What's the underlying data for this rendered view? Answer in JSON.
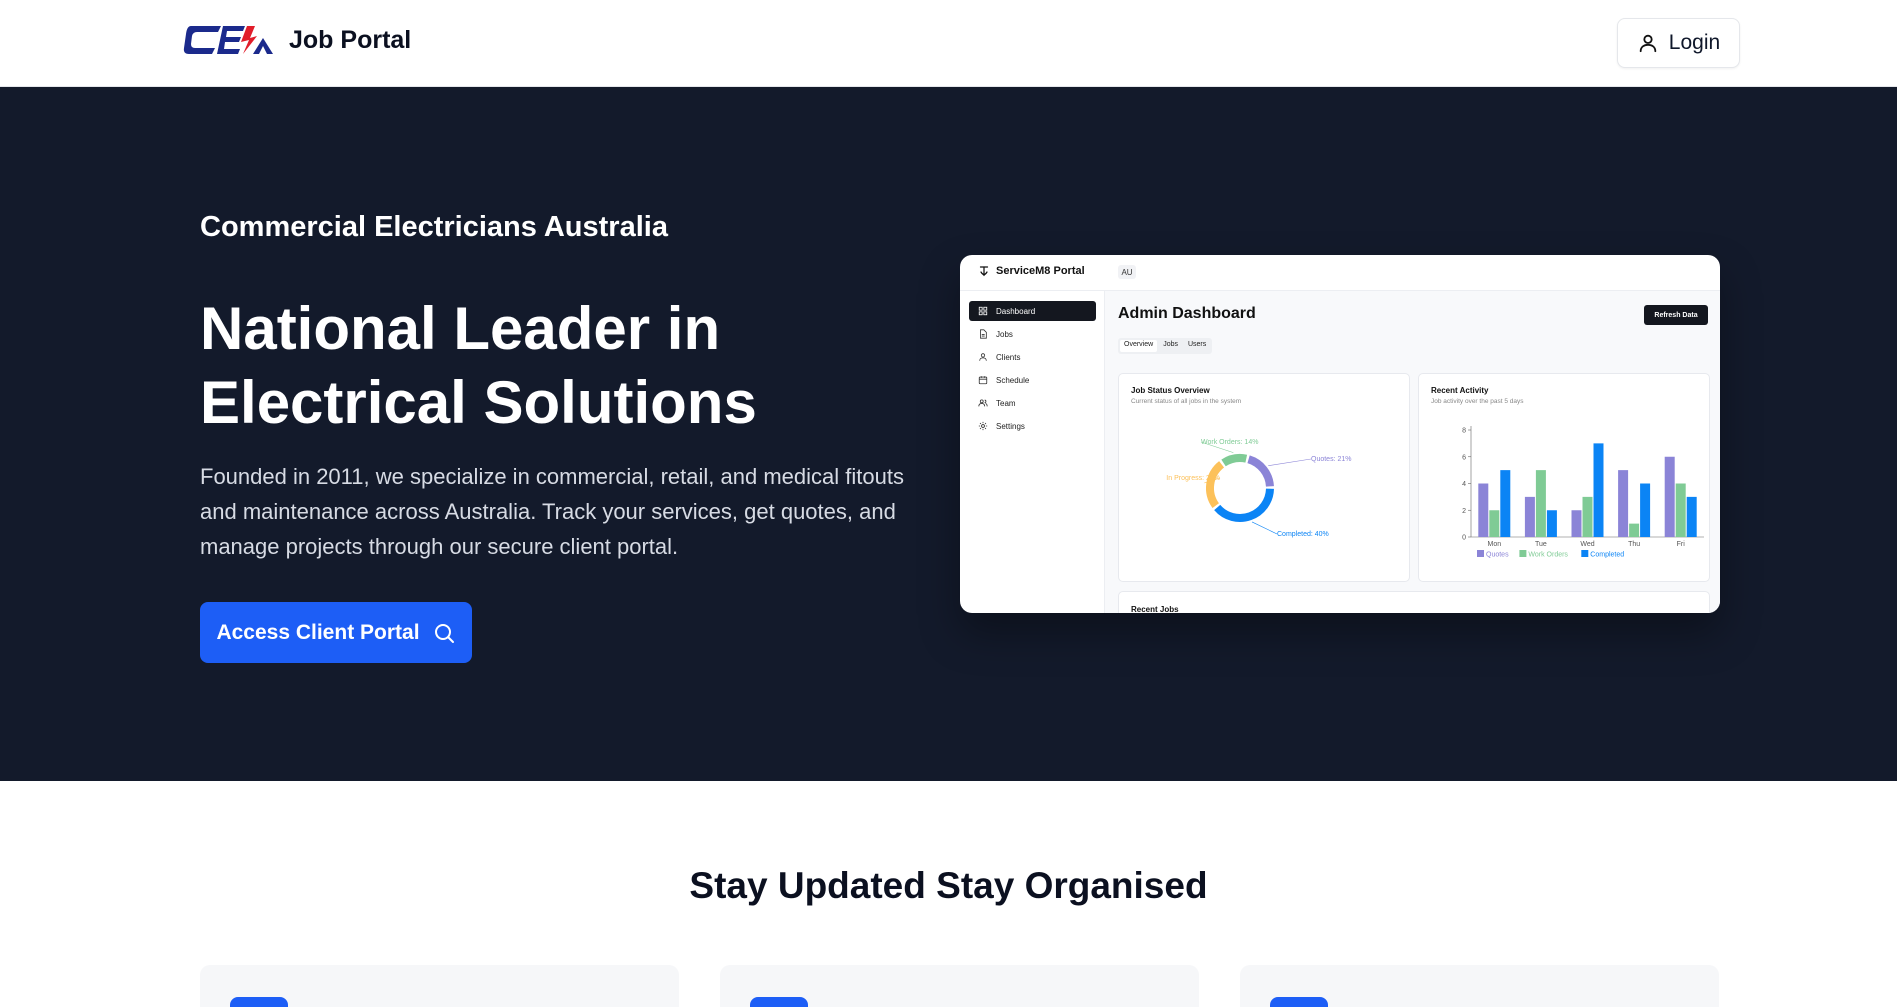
{
  "header": {
    "brand_title": "Job Portal",
    "logo_text": "CEA",
    "login_label": "Login",
    "colors": {
      "logo_blue": "#1b2a8c",
      "logo_red": "#e11d2a"
    }
  },
  "hero": {
    "eyebrow": "Commercial Electricians Australia",
    "title_line1": "National Leader in",
    "title_line2": "Electrical Solutions",
    "description": "Founded in 2011, we specialize in commercial, retail, and medical fitouts and maintenance across Australia. Track your services, get quotes, and manage projects through our secure client portal.",
    "cta_label": "Access Client Portal",
    "cta_icon": "search-icon",
    "colors": {
      "background": "#131a2b",
      "accent": "#1d5ef6"
    }
  },
  "dashboard_preview": {
    "app_name": "ServiceM8 Portal",
    "locale_badge": "AU",
    "sidebar": [
      {
        "label": "Dashboard",
        "icon": "grid-icon",
        "active": true
      },
      {
        "label": "Jobs",
        "icon": "file-icon",
        "active": false
      },
      {
        "label": "Clients",
        "icon": "user-icon",
        "active": false
      },
      {
        "label": "Schedule",
        "icon": "calendar-icon",
        "active": false
      },
      {
        "label": "Team",
        "icon": "users-icon",
        "active": false
      },
      {
        "label": "Settings",
        "icon": "gear-icon",
        "active": false
      }
    ],
    "page_title": "Admin Dashboard",
    "refresh_label": "Refresh Data",
    "tabs": [
      {
        "label": "Overview",
        "active": true
      },
      {
        "label": "Jobs",
        "active": false
      },
      {
        "label": "Users",
        "active": false
      }
    ],
    "status_card": {
      "title": "Job Status Overview",
      "subtitle": "Current status of all jobs in the system"
    },
    "activity_card": {
      "title": "Recent Activity",
      "subtitle": "Job activity over the past 5 days"
    },
    "recent_jobs_title": "Recent Jobs"
  },
  "chart_data": [
    {
      "type": "pie",
      "title": "Job Status Overview",
      "slices": [
        {
          "name": "Quotes",
          "value": 21,
          "label": "Quotes: 21%",
          "color": "#8b84d7"
        },
        {
          "name": "Completed",
          "value": 40,
          "label": "Completed: 40%",
          "color": "#0b84f5"
        },
        {
          "name": "In Progress",
          "value": 26,
          "label": "In Progress: 26%",
          "color": "#fcc15a"
        },
        {
          "name": "Work Orders",
          "value": 14,
          "label": "Work Orders: 14%",
          "color": "#7fcb95"
        }
      ]
    },
    {
      "type": "bar",
      "title": "Recent Activity",
      "categories": [
        "Mon",
        "Tue",
        "Wed",
        "Thu",
        "Fri"
      ],
      "series": [
        {
          "name": "Quotes",
          "values": [
            4,
            3,
            2,
            5,
            6
          ],
          "color": "#8b84d7"
        },
        {
          "name": "Work Orders",
          "values": [
            2,
            5,
            3,
            1,
            4
          ],
          "color": "#7fcb95"
        },
        {
          "name": "Completed",
          "values": [
            5,
            2,
            7,
            4,
            3
          ],
          "color": "#0b84f5"
        }
      ],
      "ylim": [
        0,
        8
      ],
      "yticks": [
        "0",
        "2",
        "4",
        "6",
        "8"
      ],
      "legend": "bottom"
    }
  ],
  "features": {
    "section_title": "Stay Updated Stay Organised"
  }
}
